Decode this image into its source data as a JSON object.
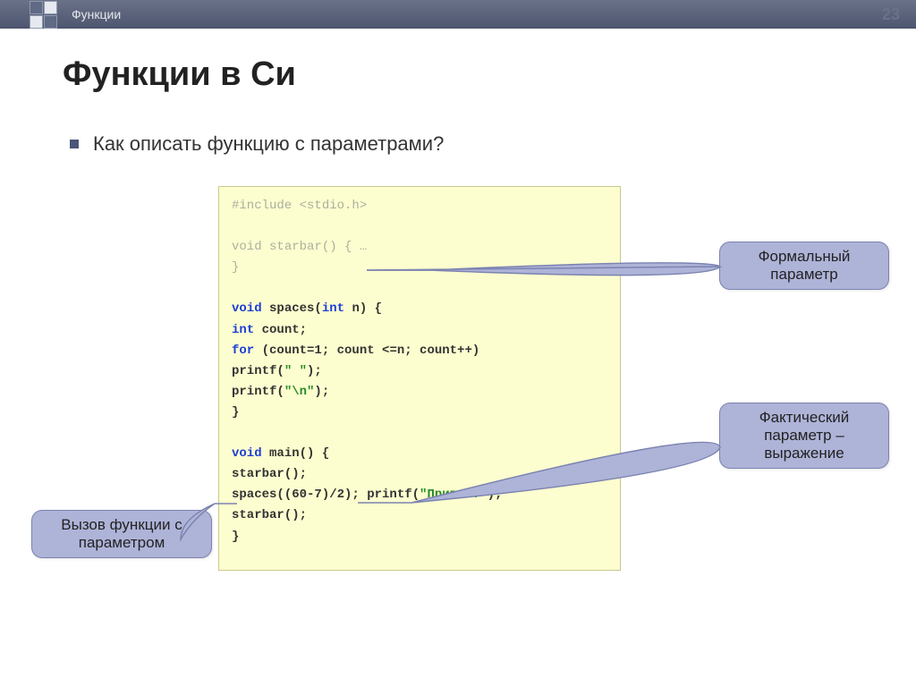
{
  "header": {
    "label": "Функции",
    "page": "23"
  },
  "title": "Функции в Си",
  "bullet": "Как описать функцию с параметрами?",
  "code": {
    "l1a": "#include ",
    "l1b": "<stdio.h>",
    "l2a": "void",
    "l2b": " starbar() {   …",
    "l3": "}",
    "l4a": "void",
    "l4b": " spaces(",
    "l4c": "int",
    "l4d": " n) {",
    "l5a": "   int",
    "l5b": " count;",
    "l6a": "   for",
    "l6b": " (count=1; count <=n; count++)",
    "l7a": "        printf(",
    "l7b": "\" \"",
    "l7c": ");",
    "l8a": "   printf(",
    "l8b": "\"\\n\"",
    "l8c": ");",
    "l9": "}",
    "l10a": "void",
    "l10b": " main() {",
    "l11": "   starbar();",
    "l12a": "   spaces((60-7)/2);  printf(",
    "l12b": "\"Привет!\"",
    "l12c": ");",
    "l13": "   starbar();",
    "l14": "}"
  },
  "callouts": {
    "c1": "Формальный параметр",
    "c2": "Фактический параметр – выражение",
    "c3": "Вызов функции с параметром"
  }
}
